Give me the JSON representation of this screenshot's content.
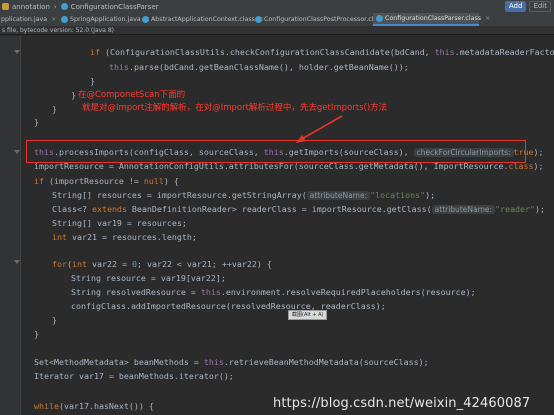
{
  "breadcrumb": {
    "items": [
      "annotation",
      "ConfigurationClassParser"
    ],
    "buttons": [
      "Add",
      "Edit"
    ]
  },
  "tabs": [
    {
      "label": "pplication.java",
      "active": false
    },
    {
      "label": "SpringApplication.java",
      "active": false
    },
    {
      "label": "AbstractApplicationContext.class",
      "active": false
    },
    {
      "label": "ConfigurationClassPostProcessor.class",
      "active": false
    },
    {
      "label": "ConfigurationClassParser.class",
      "active": true
    }
  ],
  "info_bar": "s file, bytecode version: 52.0 (Java 8)",
  "code": {
    "l1": {
      "kw": "if",
      "a": " (ConfigurationClassUtils.checkConfigurationClassCandidate(bdCand, ",
      "fld": "this",
      "b": ".metadataReaderFactory))"
    },
    "l2": {
      "fld": "this",
      "a": ".parse(bdCand.getBeanClassName(), holder.getBeanName());"
    },
    "l3": "}",
    "l4": "}",
    "l5": "}",
    "l6": "}",
    "l7": {
      "fld": "this",
      "a": ".processImports(configClass, sourceClass, ",
      "fld2": "this",
      "b": ".getImports(sourceClass), ",
      "hint": "checkForCircularImports:",
      "kw": "true",
      "c": ");"
    },
    "l8": {
      "a": "importResource = AnnotationConfigUtils.attributesFor(sourceClass.getMetadata(), ImportResource.",
      "kw": "class",
      "b": ");"
    },
    "l9": {
      "kw": "if",
      "a": " (importResource != ",
      "kw2": "null",
      "b": ") {"
    },
    "l10": {
      "a": "String[] resources = importResource.getStringArray(",
      "hint": "attributeName:",
      "str": "\"locations\"",
      "b": ");"
    },
    "l11": {
      "a": "Class<? ",
      "kw": "extends",
      "b": " BeanDefinitionReader> readerClass = importResource.getClass(",
      "hint": "attributeName:",
      "str": "\"reader\"",
      "c": ");"
    },
    "l12": {
      "a": "String[] var19 = resources;"
    },
    "l13": {
      "kw": "int",
      "a": " var21 = resources.length;"
    },
    "l14": {
      "kw": "for",
      "a": "(",
      "kw2": "int",
      "b": " var22 = ",
      "num": "0",
      "c": "; var22 < var21; ++var22) {"
    },
    "l15": {
      "a": "String resource = var19[var22];"
    },
    "l16": {
      "a": "String resolvedResource = ",
      "fld": "this",
      "b": ".environment.resolveRequiredPlaceholders(resource);"
    },
    "l17": {
      "a": "configClass.addImportedResource(resolvedResource, readerClass);"
    },
    "l18": "}",
    "l19": "}",
    "l20": {
      "a": "Set<MethodMetadata> beanMethods = ",
      "fld": "this",
      "b": ".retrieveBeanMethodMetadata(sourceClass);"
    },
    "l21": {
      "a": "Iterator var17 = beanMethods.iterator();"
    },
    "l22": {
      "kw": "while",
      "a": "(var17.hasNext()) {"
    }
  },
  "annotation": {
    "line1": "在@ComponetScan下面的",
    "line2": "就是对@Import注解的解析，在对@Import解析过程中，先去getImports()方法"
  },
  "tooltip": "截图(Alt + A)",
  "watermark": "https://blog.csdn.net/weixin_42460087",
  "colors": {
    "annotation": "#ff3b30",
    "highlight_box": "#e8342a",
    "keyword": "#cc7832",
    "field": "#9876aa",
    "string": "#6a8759"
  }
}
